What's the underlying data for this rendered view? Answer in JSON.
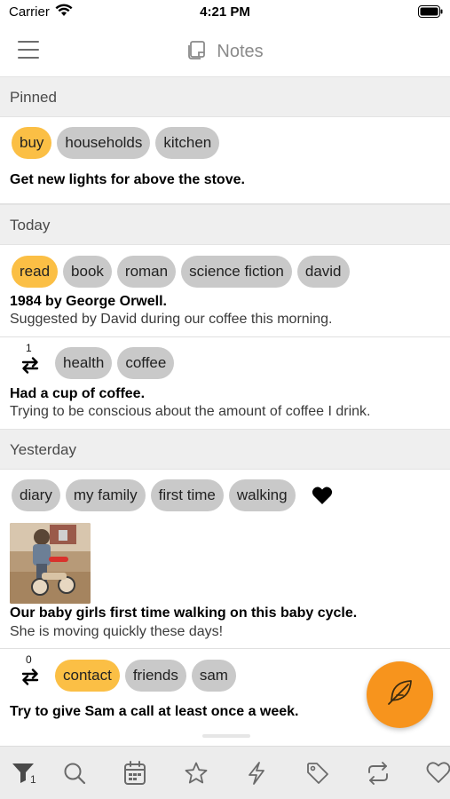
{
  "status": {
    "carrier": "Carrier",
    "time": "4:21 PM"
  },
  "header": {
    "title": "Notes",
    "menu_icon": "hamburger-menu-icon",
    "title_icon": "notes-icon"
  },
  "sections": {
    "pinned": "Pinned",
    "today": "Today",
    "yesterday": "Yesterday"
  },
  "notes": [
    {
      "tags": [
        "buy",
        "households",
        "kitchen"
      ],
      "highlighted_tag": "buy",
      "title": "Get new lights for above the stove.",
      "body": ""
    },
    {
      "tags": [
        "read",
        "book",
        "roman",
        "science fiction",
        "david"
      ],
      "highlighted_tag": "read",
      "title": "1984 by George Orwell.",
      "body": "Suggested by David during our coffee this morning."
    },
    {
      "repeat_count": "1",
      "tags": [
        "health",
        "coffee"
      ],
      "title": "Had a cup of coffee.",
      "body": "Trying to be conscious about the amount of coffee I drink."
    },
    {
      "tags": [
        "diary",
        "my family",
        "first time",
        "walking"
      ],
      "favorite": true,
      "has_photo": true,
      "title": "Our baby girls first time walking on this baby cycle.",
      "body": "She is moving quickly these days!"
    },
    {
      "repeat_count": "0",
      "tags": [
        "contact",
        "friends",
        "sam"
      ],
      "highlighted_tag": "contact",
      "title": "Try to give Sam a call at least once a week.",
      "body": ""
    }
  ],
  "fab": {
    "icon": "feather-quill-icon"
  },
  "tab_bar": {
    "filter_badge": "1",
    "icons": [
      "filter-icon",
      "search-icon",
      "calendar-icon",
      "star-icon",
      "lightning-icon",
      "tag-icon",
      "repeat-icon",
      "heart-icon"
    ]
  },
  "colors": {
    "accent_tag": "#fbbf45",
    "tag": "#c9c9c9",
    "fab": "#f7941d",
    "section_bg": "#efefef"
  }
}
